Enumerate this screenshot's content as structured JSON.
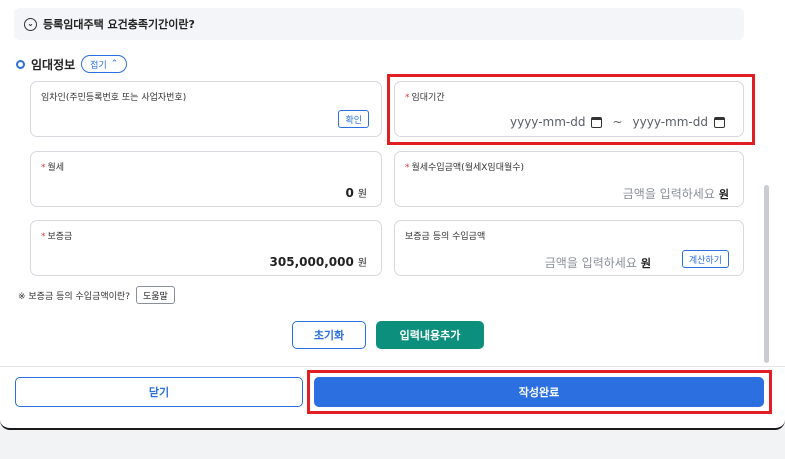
{
  "info_bar": {
    "text": "등록임대주택 요건충족기간이란?",
    "icon": "chevron-down-circle-icon"
  },
  "section": {
    "title": "임대정보",
    "fold_label": "접기",
    "fold_icon": "chevron-up-icon"
  },
  "fields": {
    "lessee_id": {
      "label": "임차인(주민등록번호 또는 사업자번호)",
      "confirm_label": "확인"
    },
    "rental_period": {
      "required": "*",
      "label": "임대기간",
      "start_placeholder": "yyyy-mm-dd",
      "separator": "~",
      "end_placeholder": "yyyy-mm-dd"
    },
    "monthly_rent": {
      "required": "*",
      "label": "월세",
      "value": "0",
      "unit": "원"
    },
    "monthly_income": {
      "required": "*",
      "label": "월세수입금액(월세X임대월수)",
      "placeholder": "금액을 입력하세요",
      "unit": "원"
    },
    "deposit": {
      "required": "*",
      "label": "보증금",
      "value": "305,000,000",
      "unit": "원"
    },
    "deposit_income": {
      "label": "보증금 등의 수입금액",
      "placeholder": "금액을 입력하세요",
      "unit": "원",
      "calc_label": "계산하기"
    }
  },
  "note": {
    "text": "※ 보증금 등의 수입금액이란?",
    "help_label": "도움말"
  },
  "actions": {
    "reset_label": "초기화",
    "add_label": "입력내용추가"
  },
  "footer": {
    "close_label": "닫기",
    "done_label": "작성완료"
  },
  "colors": {
    "primary": "#2b6fe0",
    "teal": "#0c8f7c",
    "highlight": "#e01f25",
    "required": "#e5383b"
  }
}
